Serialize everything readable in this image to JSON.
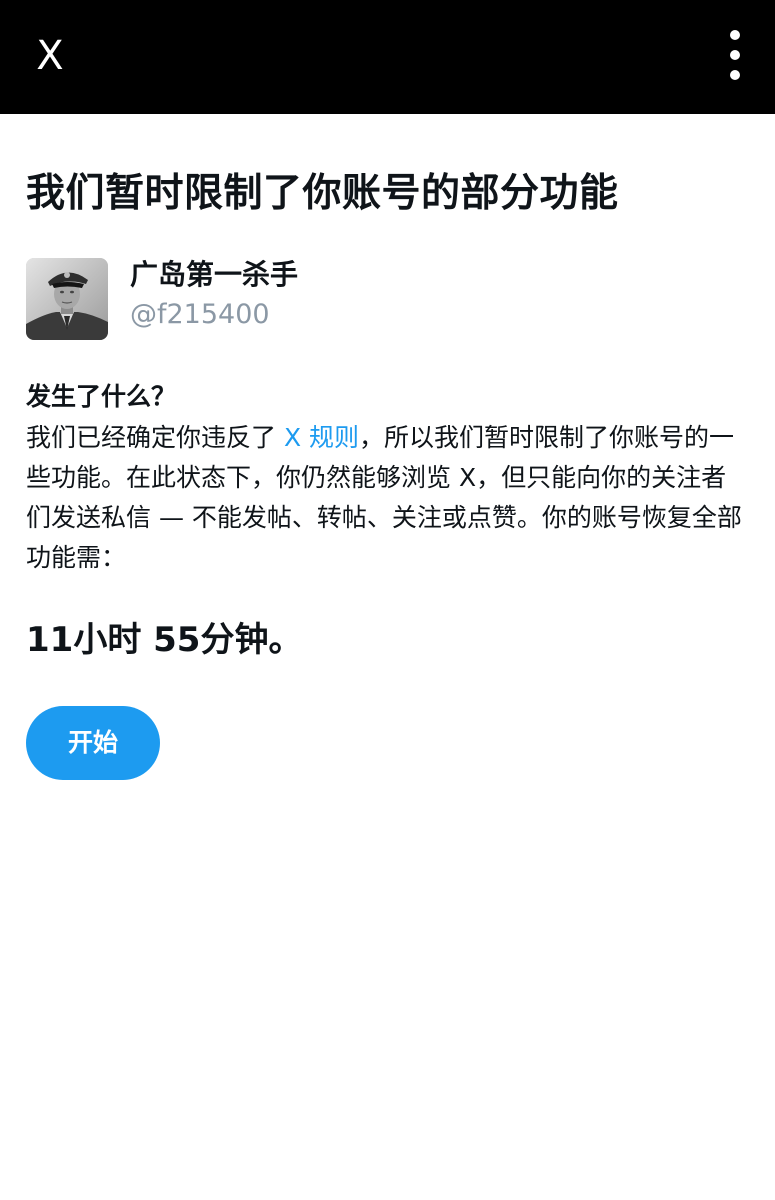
{
  "topbar": {
    "close_label": "X",
    "close_icon": "close-icon",
    "more_icon": "more-vertical-icon"
  },
  "main": {
    "title": "我们暂时限制了你账号的部分功能",
    "account": {
      "display_name": "广岛第一杀手",
      "handle": "@f215400",
      "avatar_icon": "avatar"
    },
    "what_happened": {
      "heading": "发生了什么？",
      "text_before_link": "我们已经确定你违反了 ",
      "link_text": "X 规则",
      "text_after_link": "，所以我们暂时限制了你账号的一些功能。在此状态下，你仍然能够浏览 X，但只能向你的关注者们发送私信 — 不能发帖、转帖、关注或点赞。你的账号恢复全部功能需："
    },
    "duration": "11小时 55分钟。",
    "start_button_label": "开始"
  },
  "colors": {
    "topbar": "#000000",
    "accent": "#1d9bf0",
    "handle": "#8b98a5",
    "text": "#0f1419"
  }
}
